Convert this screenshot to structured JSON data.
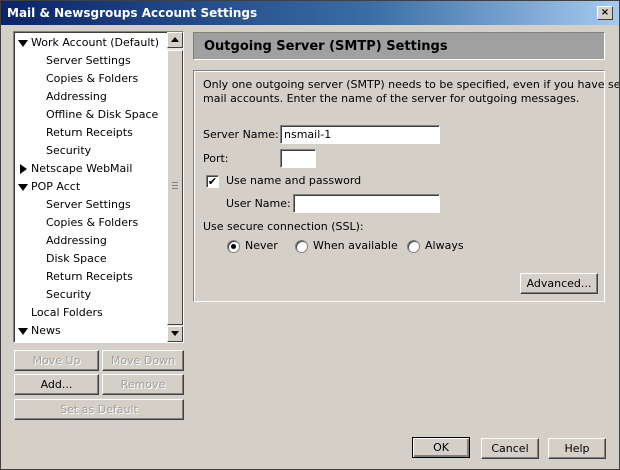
{
  "window": {
    "title": "Mail & Newsgroups Account Settings",
    "close_glyph": "×"
  },
  "tree": {
    "items": [
      {
        "label": "Work Account (Default)",
        "level": 0,
        "twisty": "open"
      },
      {
        "label": "Server Settings",
        "level": 1
      },
      {
        "label": "Copies & Folders",
        "level": 1
      },
      {
        "label": "Addressing",
        "level": 1
      },
      {
        "label": "Offline & Disk Space",
        "level": 1
      },
      {
        "label": "Return Receipts",
        "level": 1
      },
      {
        "label": "Security",
        "level": 1
      },
      {
        "label": "Netscape WebMail",
        "level": 0,
        "twisty": "closed"
      },
      {
        "label": "POP Acct",
        "level": 0,
        "twisty": "open"
      },
      {
        "label": "Server Settings",
        "level": 1
      },
      {
        "label": "Copies & Folders",
        "level": 1
      },
      {
        "label": "Addressing",
        "level": 1
      },
      {
        "label": "Disk Space",
        "level": 1
      },
      {
        "label": "Return Receipts",
        "level": 1
      },
      {
        "label": "Security",
        "level": 1
      },
      {
        "label": "Local Folders",
        "level": 0
      },
      {
        "label": "News",
        "level": 0,
        "twisty": "open"
      }
    ]
  },
  "left_buttons": {
    "move_up": "Move Up",
    "move_down": "Move Down",
    "add": "Add...",
    "remove": "Remove",
    "set_default": "Set as Default"
  },
  "main": {
    "header": "Outgoing Server (SMTP) Settings",
    "description_line1": "Only one outgoing server (SMTP) needs to be specified, even if you have several",
    "description_line2": "mail accounts. Enter the name of the server for outgoing messages.",
    "server_name_label": "Server Name:",
    "server_name_value": "nsmail-1",
    "port_label": "Port:",
    "port_value": "",
    "use_auth_label": "Use name and password",
    "use_auth_checked": true,
    "username_label": "User Name:",
    "username_value": "",
    "ssl_label": "Use secure connection (SSL):",
    "ssl_options": [
      "Never",
      "When available",
      "Always"
    ],
    "ssl_selected": "Never",
    "advanced_button": "Advanced..."
  },
  "footer": {
    "ok": "OK",
    "cancel": "Cancel",
    "help": "Help"
  }
}
